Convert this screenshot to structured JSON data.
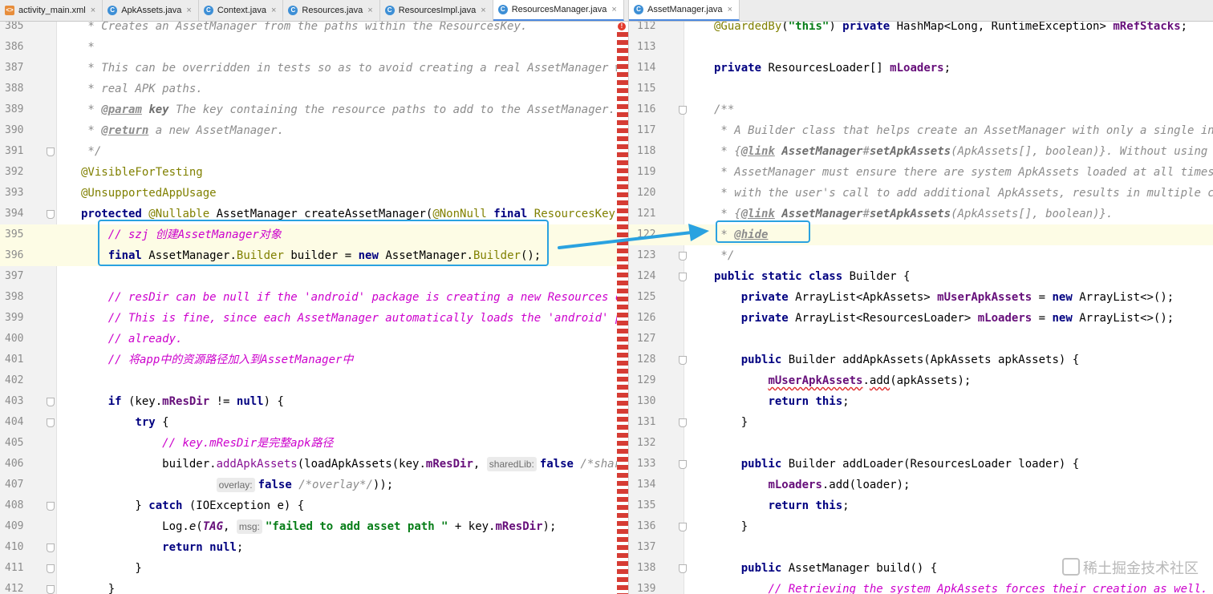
{
  "left_tabs": [
    {
      "label": "activity_main.xml",
      "icon": "xml-file-icon",
      "active": false
    },
    {
      "label": "ApkAssets.java",
      "icon": "java-class-icon",
      "active": false
    },
    {
      "label": "Context.java",
      "icon": "java-class-icon",
      "active": false
    },
    {
      "label": "Resources.java",
      "icon": "java-class-icon",
      "active": false
    },
    {
      "label": "ResourcesImpl.java",
      "icon": "java-class-icon",
      "active": false
    },
    {
      "label": "ResourcesManager.java",
      "icon": "java-class-icon",
      "active": true
    }
  ],
  "right_tabs": [
    {
      "label": "AssetManager.java",
      "icon": "java-class-icon",
      "active": true
    }
  ],
  "left_lines": [
    {
      "num": "385",
      "segs": [
        [
          "c",
          " * Creates an AssetManager from the paths within the ResourcesKey."
        ]
      ]
    },
    {
      "num": "386",
      "segs": [
        [
          "c",
          " *"
        ]
      ]
    },
    {
      "num": "387",
      "segs": [
        [
          "c",
          " * This can be overridden in tests so as to avoid creating a real AssetManager with"
        ]
      ]
    },
    {
      "num": "388",
      "segs": [
        [
          "c",
          " * real APK paths."
        ]
      ]
    },
    {
      "num": "389",
      "segs": [
        [
          "c",
          " * "
        ],
        [
          "tg",
          "@param"
        ],
        [
          "c",
          " "
        ],
        [
          "ck",
          "key"
        ],
        [
          "c",
          " The key containing the resource paths to add to the AssetManager."
        ]
      ]
    },
    {
      "num": "390",
      "segs": [
        [
          "c",
          " * "
        ],
        [
          "tg",
          "@return"
        ],
        [
          "c",
          " a new AssetManager."
        ]
      ]
    },
    {
      "num": "391",
      "segs": [
        [
          "c",
          " */"
        ]
      ]
    },
    {
      "num": "392",
      "segs": [
        [
          "t",
          ""
        ],
        [
          "an",
          "@VisibleForTesting"
        ]
      ]
    },
    {
      "num": "393",
      "segs": [
        [
          "t",
          ""
        ],
        [
          "an",
          "@UnsupportedAppUsage"
        ]
      ]
    },
    {
      "num": "394",
      "segs": [
        [
          "kw",
          "protected "
        ],
        [
          "an",
          "@Nullable"
        ],
        [
          "t",
          " AssetManager createAssetManager("
        ],
        [
          "an",
          "@NonNull"
        ],
        [
          "t",
          " "
        ],
        [
          "kw",
          "final"
        ],
        [
          "t",
          " "
        ],
        [
          "cls",
          "ResourcesKey"
        ],
        [
          "t",
          " k"
        ]
      ]
    },
    {
      "num": "395",
      "hl": true,
      "segs": [
        [
          "t",
          "    "
        ],
        [
          "zh",
          "// szj 创建AssetManager对象"
        ]
      ]
    },
    {
      "num": "396",
      "hl": true,
      "segs": [
        [
          "t",
          "    "
        ],
        [
          "kw",
          "final"
        ],
        [
          "t",
          " AssetManager."
        ],
        [
          "cls",
          "Builder"
        ],
        [
          "t",
          " builder = "
        ],
        [
          "kw",
          "new"
        ],
        [
          "t",
          " AssetManager."
        ],
        [
          "cls",
          "Builder"
        ],
        [
          "t",
          "();"
        ]
      ]
    },
    {
      "num": "397",
      "segs": []
    },
    {
      "num": "398",
      "segs": [
        [
          "t",
          "    "
        ],
        [
          "zh",
          "// resDir can be null if the 'android' package is creating a new Resources object."
        ]
      ]
    },
    {
      "num": "399",
      "segs": [
        [
          "t",
          "    "
        ],
        [
          "zh",
          "// This is fine, since each AssetManager automatically loads the 'android' package"
        ]
      ]
    },
    {
      "num": "400",
      "segs": [
        [
          "t",
          "    "
        ],
        [
          "zh",
          "// already."
        ]
      ]
    },
    {
      "num": "401",
      "segs": [
        [
          "t",
          "    "
        ],
        [
          "zh",
          "// 将app中的资源路径加入到AssetManager中"
        ]
      ]
    },
    {
      "num": "402",
      "segs": []
    },
    {
      "num": "403",
      "segs": [
        [
          "t",
          "    "
        ],
        [
          "kw",
          "if"
        ],
        [
          "t",
          " (key."
        ],
        [
          "fld",
          "mResDir"
        ],
        [
          "t",
          " != "
        ],
        [
          "kw",
          "null"
        ],
        [
          "t",
          ") {"
        ]
      ]
    },
    {
      "num": "404",
      "segs": [
        [
          "t",
          "        "
        ],
        [
          "kw",
          "try"
        ],
        [
          "t",
          " {"
        ]
      ]
    },
    {
      "num": "405",
      "segs": [
        [
          "t",
          "            "
        ],
        [
          "zh",
          "// key.mResDir是完整apk路径"
        ]
      ]
    },
    {
      "num": "406",
      "segs": [
        [
          "t",
          "            builder."
        ],
        [
          "mc",
          "addApkAssets"
        ],
        [
          "t",
          "(loadApkAssets(key."
        ],
        [
          "fld",
          "mResDir"
        ],
        [
          "t",
          ", "
        ],
        [
          "hint",
          "sharedLib:"
        ],
        [
          "kw",
          "false"
        ],
        [
          "t",
          " "
        ],
        [
          "c",
          "/*sharedLib*/"
        ]
      ]
    },
    {
      "num": "407",
      "segs": [
        [
          "t",
          "                    "
        ],
        [
          "hint",
          "overlay:"
        ],
        [
          "kw",
          "false"
        ],
        [
          "t",
          " "
        ],
        [
          "c",
          "/*overlay*/"
        ],
        [
          "t",
          "));"
        ]
      ]
    },
    {
      "num": "408",
      "segs": [
        [
          "t",
          "        } "
        ],
        [
          "kw",
          "catch"
        ],
        [
          "t",
          " (IOException e) {"
        ]
      ]
    },
    {
      "num": "409",
      "segs": [
        [
          "t",
          "            Log."
        ],
        [
          "ital",
          "e"
        ],
        [
          "t",
          "("
        ],
        [
          "ifd",
          "TAG"
        ],
        [
          "t",
          ", "
        ],
        [
          "hint",
          "msg:"
        ],
        [
          "str",
          "\"failed to add asset path \""
        ],
        [
          "t",
          " + key."
        ],
        [
          "fld",
          "mResDir"
        ],
        [
          "t",
          ");"
        ]
      ]
    },
    {
      "num": "410",
      "segs": [
        [
          "t",
          "            "
        ],
        [
          "kw",
          "return"
        ],
        [
          "t",
          " "
        ],
        [
          "kw",
          "null"
        ],
        [
          "t",
          ";"
        ]
      ]
    },
    {
      "num": "411",
      "segs": [
        [
          "t",
          "        }"
        ]
      ]
    },
    {
      "num": "412",
      "segs": [
        [
          "t",
          "    }"
        ]
      ]
    }
  ],
  "right_lines": [
    {
      "num": "112",
      "segs": [
        [
          "an",
          "@GuardedBy"
        ],
        [
          "t",
          "("
        ],
        [
          "str",
          "\"this\""
        ],
        [
          "t",
          ") "
        ],
        [
          "kw",
          "private"
        ],
        [
          "t",
          " HashMap<Long, RuntimeException> "
        ],
        [
          "fld",
          "mRefStacks"
        ],
        [
          "t",
          ";"
        ]
      ]
    },
    {
      "num": "113",
      "segs": []
    },
    {
      "num": "114",
      "segs": [
        [
          "kw",
          "private"
        ],
        [
          "t",
          " ResourcesLoader[] "
        ],
        [
          "fld",
          "mLoaders"
        ],
        [
          "t",
          ";"
        ]
      ]
    },
    {
      "num": "115",
      "segs": []
    },
    {
      "num": "116",
      "segs": [
        [
          "c",
          "/**"
        ]
      ]
    },
    {
      "num": "117",
      "segs": [
        [
          "c",
          " * A Builder class that helps create an AssetManager with only a single invocation of"
        ]
      ]
    },
    {
      "num": "118",
      "segs": [
        [
          "c",
          " * {"
        ],
        [
          "tg",
          "@link"
        ],
        [
          "c",
          " "
        ],
        [
          "ck",
          "AssetManager"
        ],
        [
          "c",
          "#"
        ],
        [
          "ck",
          "setApkAssets"
        ],
        [
          "c",
          "(ApkAssets[], boolean)}. Without using this builder,"
        ]
      ]
    },
    {
      "num": "119",
      "segs": [
        [
          "c",
          " * AssetManager must ensure there are system ApkAssets loaded at all times when an"
        ]
      ]
    },
    {
      "num": "120",
      "segs": [
        [
          "c",
          " * with the user's call to add additional ApkAssets, results in multiple calls to"
        ]
      ]
    },
    {
      "num": "121",
      "segs": [
        [
          "c",
          " * {"
        ],
        [
          "tg",
          "@link"
        ],
        [
          "c",
          " "
        ],
        [
          "ck",
          "AssetManager"
        ],
        [
          "c",
          "#"
        ],
        [
          "ck",
          "setApkAssets"
        ],
        [
          "c",
          "(ApkAssets[], boolean)}."
        ]
      ]
    },
    {
      "num": "122",
      "hl": true,
      "segs": [
        [
          "c",
          " * "
        ],
        [
          "tg",
          "@hide"
        ]
      ]
    },
    {
      "num": "123",
      "segs": [
        [
          "c",
          " */"
        ]
      ]
    },
    {
      "num": "124",
      "segs": [
        [
          "kw",
          "public static class"
        ],
        [
          "t",
          " Builder {"
        ]
      ]
    },
    {
      "num": "125",
      "segs": [
        [
          "t",
          "    "
        ],
        [
          "kw",
          "private"
        ],
        [
          "t",
          " ArrayList<ApkAssets> "
        ],
        [
          "fld",
          "mUserApkAssets"
        ],
        [
          "t",
          " = "
        ],
        [
          "kw",
          "new"
        ],
        [
          "t",
          " ArrayList<>();"
        ]
      ]
    },
    {
      "num": "126",
      "segs": [
        [
          "t",
          "    "
        ],
        [
          "kw",
          "private"
        ],
        [
          "t",
          " ArrayList<ResourcesLoader> "
        ],
        [
          "fld",
          "mLoaders"
        ],
        [
          "t",
          " = "
        ],
        [
          "kw",
          "new"
        ],
        [
          "t",
          " ArrayList<>();"
        ]
      ]
    },
    {
      "num": "127",
      "segs": []
    },
    {
      "num": "128",
      "segs": [
        [
          "t",
          "    "
        ],
        [
          "kw",
          "public"
        ],
        [
          "t",
          " Builder addApkAssets(ApkAssets apkAssets) {"
        ]
      ]
    },
    {
      "num": "129",
      "segs": [
        [
          "t",
          "        "
        ],
        [
          "fle",
          "mUserApkAssets"
        ],
        [
          "t",
          "."
        ],
        [
          "ule",
          "add"
        ],
        [
          "t",
          "(apkAssets);"
        ]
      ]
    },
    {
      "num": "130",
      "segs": [
        [
          "t",
          "        "
        ],
        [
          "kw",
          "return this"
        ],
        [
          "t",
          ";"
        ]
      ]
    },
    {
      "num": "131",
      "segs": [
        [
          "t",
          "    }"
        ]
      ]
    },
    {
      "num": "132",
      "segs": []
    },
    {
      "num": "133",
      "segs": [
        [
          "t",
          "    "
        ],
        [
          "kw",
          "public"
        ],
        [
          "t",
          " Builder addLoader(ResourcesLoader loader) {"
        ]
      ]
    },
    {
      "num": "134",
      "segs": [
        [
          "t",
          "        "
        ],
        [
          "fld",
          "mLoaders"
        ],
        [
          "t",
          ".add(loader);"
        ]
      ]
    },
    {
      "num": "135",
      "segs": [
        [
          "t",
          "        "
        ],
        [
          "kw",
          "return this"
        ],
        [
          "t",
          ";"
        ]
      ]
    },
    {
      "num": "136",
      "segs": [
        [
          "t",
          "    }"
        ]
      ]
    },
    {
      "num": "137",
      "segs": []
    },
    {
      "num": "138",
      "segs": [
        [
          "t",
          "    "
        ],
        [
          "kw",
          "public"
        ],
        [
          "t",
          " AssetManager build() {"
        ]
      ]
    },
    {
      "num": "139",
      "segs": [
        [
          "t",
          "        "
        ],
        [
          "zh",
          "// Retrieving the system ApkAssets forces their creation as well."
        ]
      ]
    }
  ],
  "watermark": "稀土掘金技术社区",
  "colors": {
    "highlight_box": "#2aa2e0",
    "arrow": "#2aa2e0",
    "error_stripe": "#d63c34"
  }
}
